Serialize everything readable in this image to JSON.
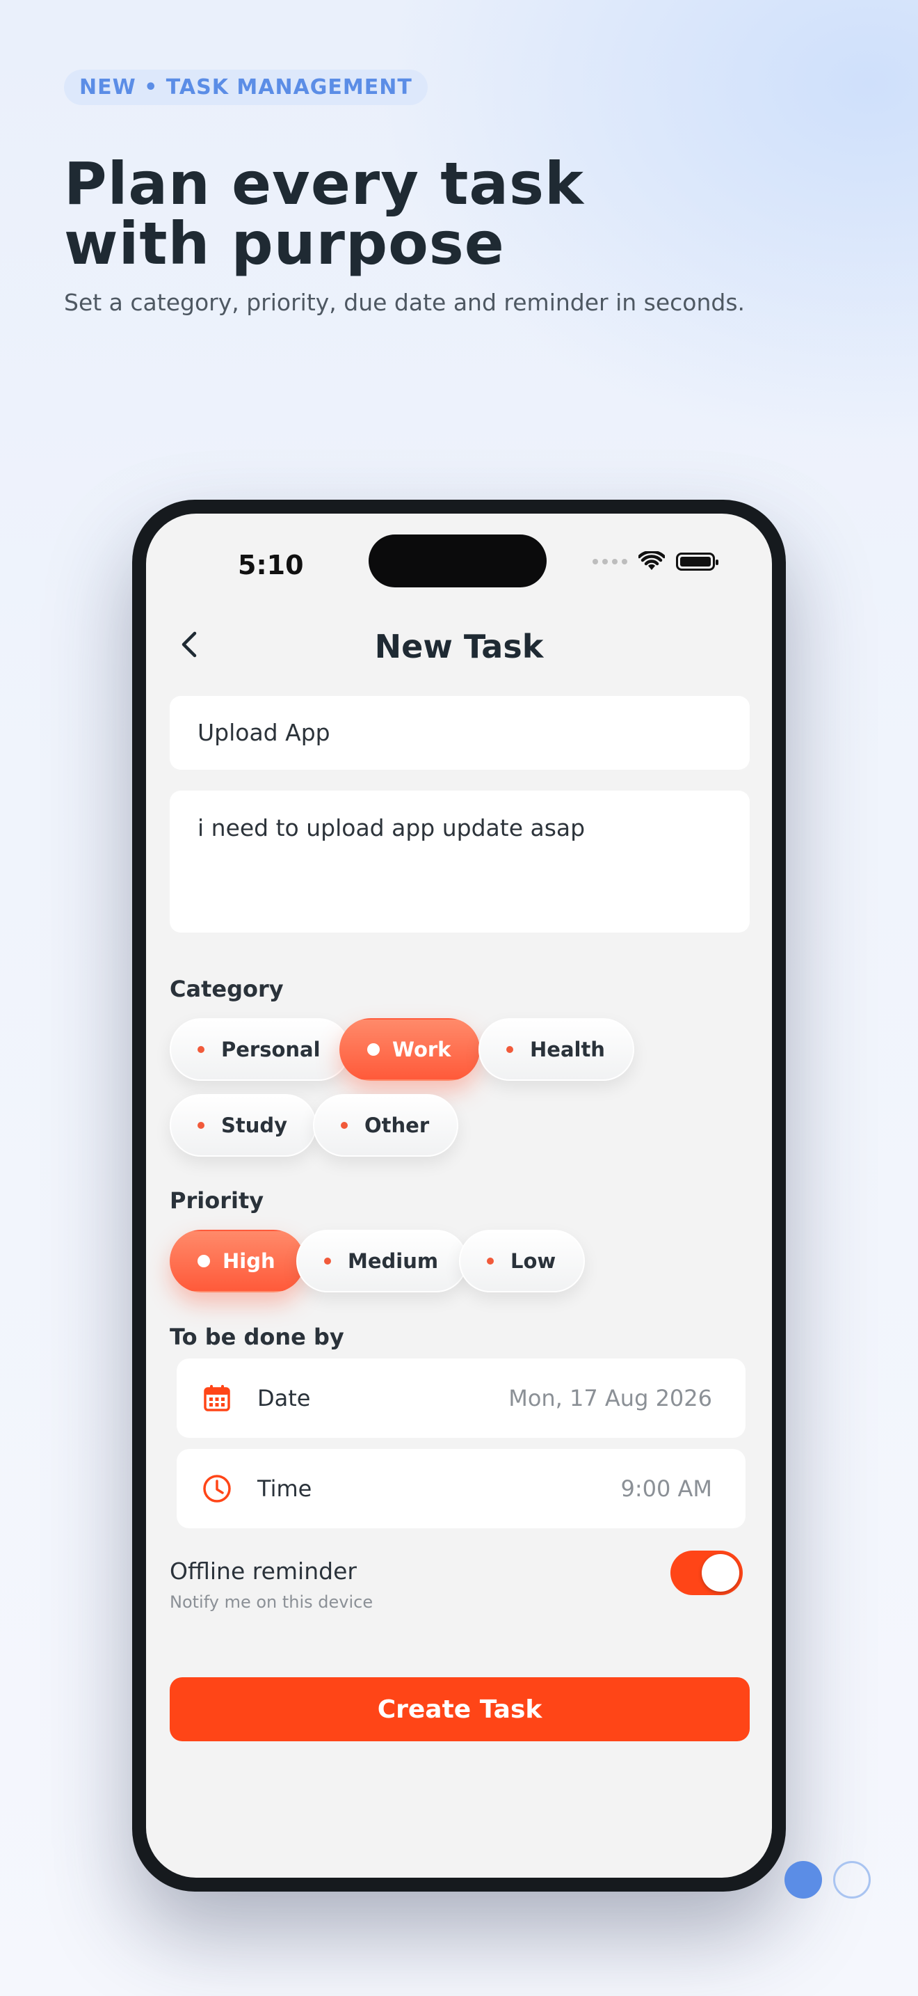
{
  "hero": {
    "badge": "NEW • TASK MANAGEMENT",
    "headline_line1": "Plan every task",
    "headline_line2": "with purpose",
    "subhead": "Set a category, priority, due date and reminder in seconds."
  },
  "status_bar": {
    "time": "5:10"
  },
  "nav": {
    "title": "New Task",
    "back_icon": "chevron-left-icon"
  },
  "form": {
    "title_value": "Upload App",
    "description_value": "i need to upload app update asap",
    "category_label": "Category",
    "categories": [
      {
        "label": "Personal",
        "selected": false
      },
      {
        "label": "Work",
        "selected": true
      },
      {
        "label": "Health",
        "selected": false
      },
      {
        "label": "Study",
        "selected": false
      },
      {
        "label": "Other",
        "selected": false
      }
    ],
    "priority_label": "Priority",
    "priorities": [
      {
        "label": "High",
        "selected": true
      },
      {
        "label": "Medium",
        "selected": false
      },
      {
        "label": "Low",
        "selected": false
      }
    ],
    "due_label": "To be done by",
    "date": {
      "label": "Date",
      "value": "Mon, 17 Aug 2026",
      "icon": "calendar-icon"
    },
    "time": {
      "label": "Time",
      "value": "9:00 AM",
      "icon": "clock-icon"
    },
    "reminder": {
      "title": "Offline reminder",
      "subtitle": "Notify me on this device",
      "enabled": true
    },
    "submit_label": "Create Task"
  },
  "colors": {
    "accent": "#ff4517",
    "chip_active": "#ff5a3a",
    "badge_text": "#5b8de6",
    "headline": "#1f2a33"
  },
  "pager": {
    "current": 1,
    "total": 2
  }
}
